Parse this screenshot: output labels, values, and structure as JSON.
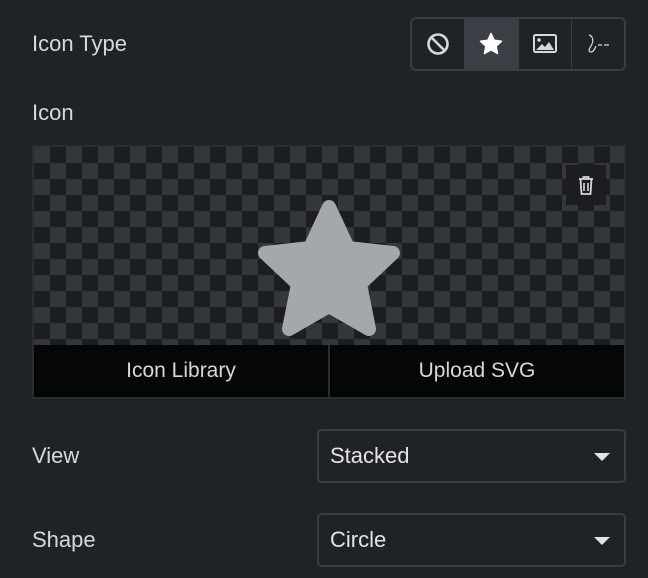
{
  "icon_type": {
    "label": "Icon Type",
    "options": [
      {
        "icon": "ban-icon",
        "active": false
      },
      {
        "icon": "star-icon",
        "active": true
      },
      {
        "icon": "image-icon",
        "active": false
      },
      {
        "icon": "signature-icon",
        "active": false
      }
    ]
  },
  "icon": {
    "label": "Icon",
    "selected_icon": "star-icon",
    "preview_color": "#a4a7ab",
    "library_label": "Icon Library",
    "upload_label": "Upload SVG",
    "delete_icon": "trash-icon"
  },
  "view": {
    "label": "View",
    "value": "Stacked"
  },
  "shape": {
    "label": "Shape",
    "value": "Circle"
  }
}
